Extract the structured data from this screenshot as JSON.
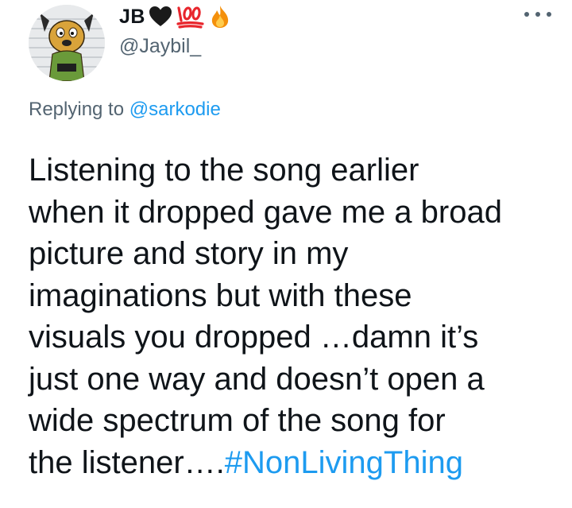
{
  "author": {
    "display_name": "JB",
    "handle": "@Jaybil_",
    "badges": [
      "black-heart-icon",
      "hundred-points-icon",
      "fire-icon"
    ]
  },
  "reply_context": {
    "prefix": "Replying to",
    "mention": "@sarkodie"
  },
  "tweet": {
    "lines": [
      "Listening to the song earlier",
      "when it dropped gave me a broad",
      "picture and story in my",
      "imaginations but with these",
      "visuals you dropped …damn it’s",
      "just one way and doesn’t open a",
      "wide  spectrum of the song for",
      "the listener….",
      "#NonLivingThing"
    ]
  },
  "colors": {
    "text": "#0f1419",
    "secondary": "#536471",
    "link": "#1d9bf0"
  },
  "icons": {
    "more": "more-options-icon"
  }
}
